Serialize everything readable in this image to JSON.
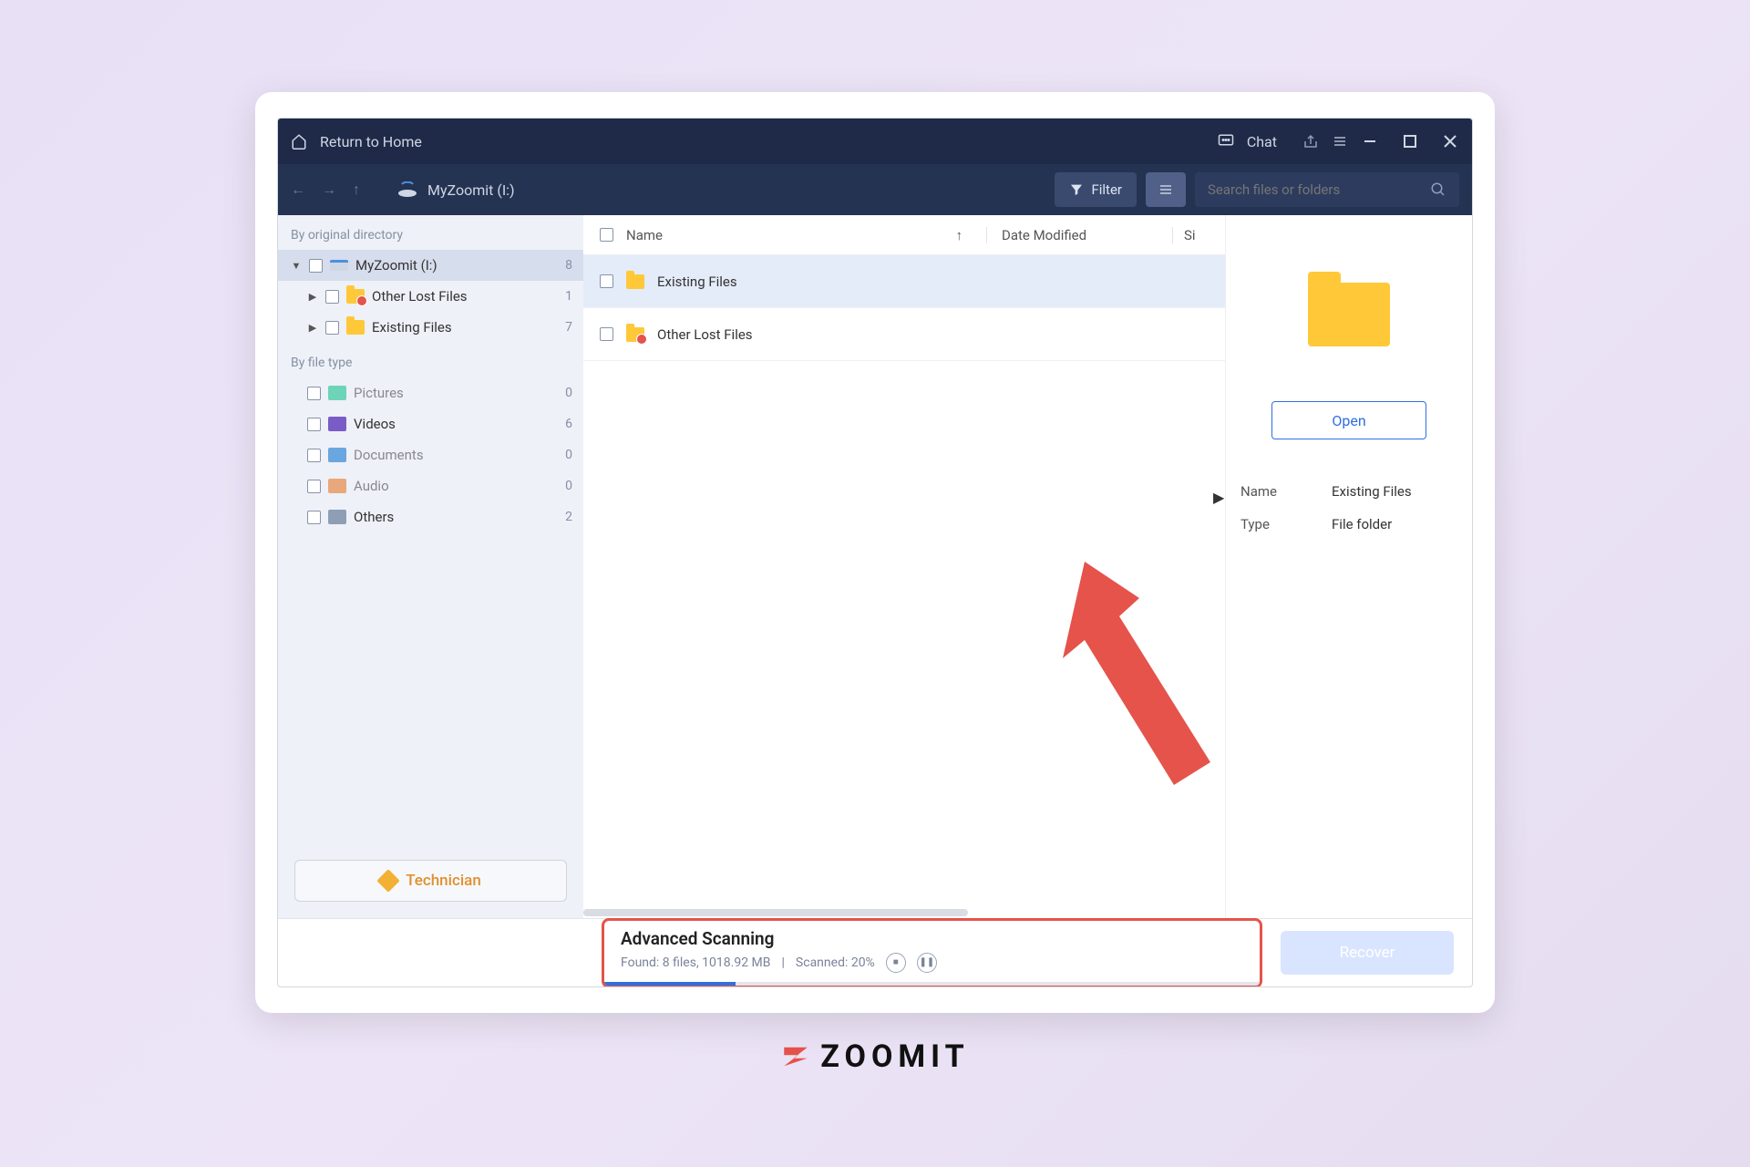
{
  "titlebar": {
    "home_label": "Return to Home",
    "chat_label": "Chat"
  },
  "toolbar": {
    "drive_label": "MyZoomit (I:)",
    "filter_label": "Filter",
    "search_placeholder": "Search files or folders"
  },
  "sidebar": {
    "section_directory": "By original directory",
    "section_filetype": "By file type",
    "tree": [
      {
        "label": "MyZoomit (I:)",
        "count": "8",
        "indent": 0,
        "selected": true,
        "icon": "drive",
        "chev": "▼"
      },
      {
        "label": "Other Lost Files",
        "count": "1",
        "indent": 1,
        "icon": "folder-lost",
        "chev": "▶"
      },
      {
        "label": "Existing Files",
        "count": "7",
        "indent": 1,
        "icon": "folder",
        "chev": "▶"
      }
    ],
    "filetypes": [
      {
        "label": "Pictures",
        "count": "0",
        "cls": "ft-pictures",
        "faded": true
      },
      {
        "label": "Videos",
        "count": "6",
        "cls": "ft-videos",
        "faded": false
      },
      {
        "label": "Documents",
        "count": "0",
        "cls": "ft-documents",
        "faded": true
      },
      {
        "label": "Audio",
        "count": "0",
        "cls": "ft-audio",
        "faded": true
      },
      {
        "label": "Others",
        "count": "2",
        "cls": "ft-others",
        "faded": false
      }
    ],
    "technician_label": "Technician"
  },
  "filelist": {
    "col_name": "Name",
    "col_date": "Date Modified",
    "col_size": "Si",
    "rows": [
      {
        "label": "Existing Files",
        "icon": "folder",
        "selected": true
      },
      {
        "label": "Other Lost Files",
        "icon": "folder-lost",
        "selected": false
      }
    ]
  },
  "detail": {
    "open_label": "Open",
    "name_key": "Name",
    "name_val": "Existing Files",
    "type_key": "Type",
    "type_val": "File folder"
  },
  "footer": {
    "scan_title": "Advanced Scanning",
    "scan_found": "Found: 8 files, 1018.92 MB",
    "scan_sep": "|",
    "scan_pct": "Scanned: 20%",
    "progress_pct": 20,
    "recover_label": "Recover"
  },
  "watermark": "ZOOMIT"
}
